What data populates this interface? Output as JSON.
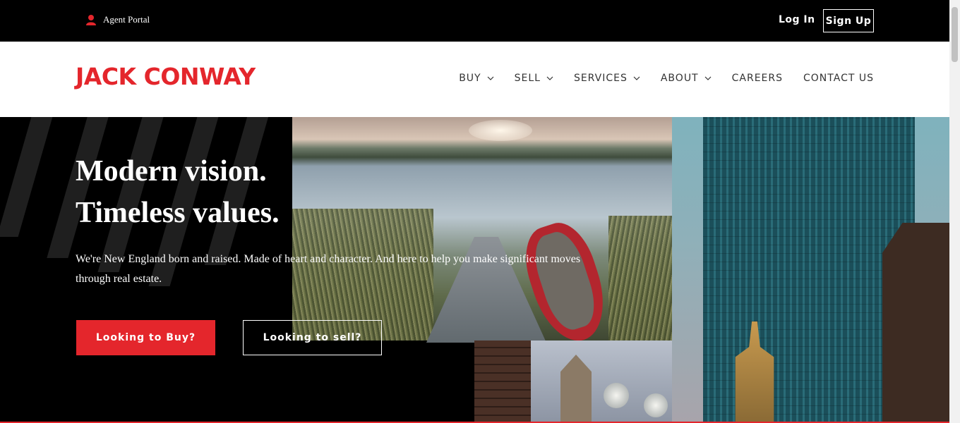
{
  "topbar": {
    "agent_portal_label": "Agent Portal",
    "agent_icon": "user-icon",
    "login_label": "Log In",
    "signup_label": "Sign Up"
  },
  "header": {
    "logo_text": "JACK CONWAY",
    "nav": [
      {
        "label": "BUY",
        "dropdown": true
      },
      {
        "label": "SELL",
        "dropdown": true
      },
      {
        "label": "SERVICES",
        "dropdown": true
      },
      {
        "label": "ABOUT",
        "dropdown": true
      },
      {
        "label": "CAREERS",
        "dropdown": false
      },
      {
        "label": "CONTACT US",
        "dropdown": false
      }
    ]
  },
  "hero": {
    "title_line1": "Modern vision.",
    "title_line2": "Timeless values.",
    "description": "We're New England born and raised. Made of heart and character. And here to help you make significant moves through real estate.",
    "buy_button": "Looking to Buy?",
    "sell_button": "Looking to sell?"
  },
  "colors": {
    "brand_red": "#e4262c",
    "topbar_bg": "#000000",
    "header_bg": "#ffffff",
    "nav_text": "#333333"
  }
}
